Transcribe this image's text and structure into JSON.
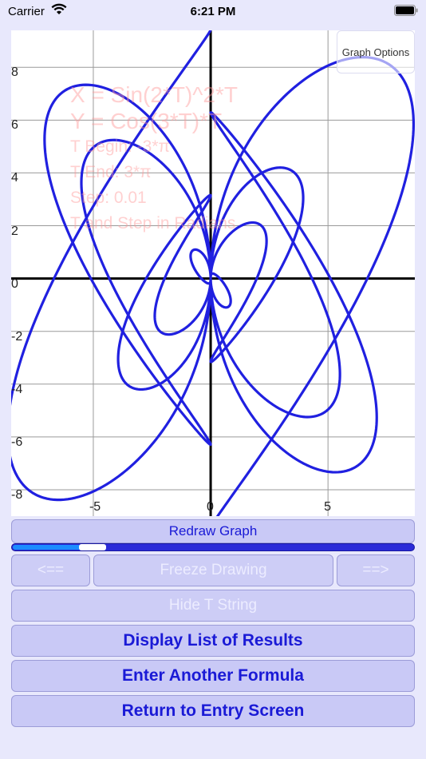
{
  "status": {
    "carrier": "Carrier",
    "time": "6:21 PM"
  },
  "graph": {
    "options_label": "Graph Options",
    "x_range": [
      -8.5,
      8.7
    ],
    "y_range": [
      -9.0,
      9.4
    ],
    "x_ticks": [
      "-5",
      "0",
      "5"
    ],
    "y_ticks": [
      "8",
      "6",
      "4",
      "2",
      "0",
      "-2",
      "-4",
      "-6",
      "-8"
    ],
    "curve_color": "#2020e0",
    "curve_x_formula": "sin(2t)^2 * t",
    "curve_y_formula": "cos(3t) * t",
    "t_begin": -9.42477,
    "t_end": 9.42477,
    "t_step": 0.01
  },
  "overlay": {
    "x_eq": "X = Sin(2*T)^2*T",
    "y_eq": "Y = Cos(3*T)*T",
    "t_begin": "T Begin: -3*π",
    "t_end": "T End: 3*π",
    "step": "Step: 0.01",
    "note": "T and Step in Radians"
  },
  "controls": {
    "redraw": "Redraw Graph",
    "slider_progress": 0.17,
    "prev": "<==",
    "freeze": "Freeze Drawing",
    "next": "==>",
    "hide_t": "Hide T String",
    "display_list": "Display List of Results",
    "enter_formula": "Enter Another Formula",
    "return_entry": "Return to Entry Screen"
  },
  "colors": {
    "button_bg": "#c9c9f6",
    "button_text": "#1a1ad6",
    "page_bg": "#e8e8fc"
  }
}
